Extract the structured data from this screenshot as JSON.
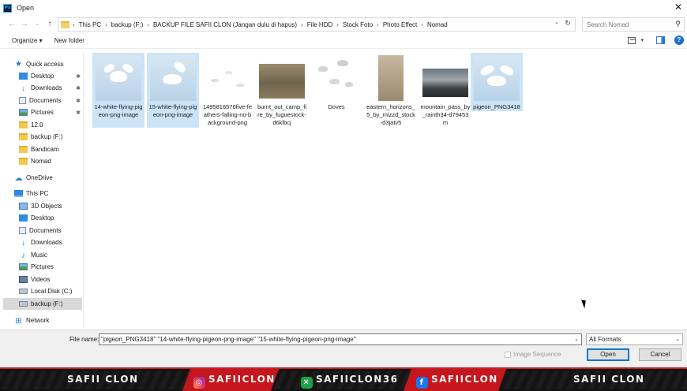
{
  "window": {
    "title": "Open",
    "app_icon": "Ps",
    "close_glyph": "✕"
  },
  "address": {
    "crumbs": [
      "This PC",
      "backup (F:)",
      "BACKUP FILE SAFII CLON (Jangan dulu di hapus)",
      "File HDD",
      "Stock Foto",
      "Photo Effect",
      "Nomad"
    ],
    "separator": "›",
    "search_placeholder": "Search Nomad"
  },
  "toolbar": {
    "organize": "Organize ▾",
    "new_folder": "New folder"
  },
  "sidebar": {
    "items": [
      {
        "label": "Quick access",
        "icon": "star-icon"
      },
      {
        "label": "Desktop",
        "icon": "desktop-icon",
        "pinned": true
      },
      {
        "label": "Downloads",
        "icon": "download-icon",
        "pinned": true
      },
      {
        "label": "Documents",
        "icon": "documents-icon",
        "pinned": true
      },
      {
        "label": "Pictures",
        "icon": "pictures-icon",
        "pinned": true
      },
      {
        "label": "12.0",
        "icon": "folder-icon"
      },
      {
        "label": "backup (F:)",
        "icon": "folder-icon"
      },
      {
        "label": "Bandicam",
        "icon": "folder-icon"
      },
      {
        "label": "Nomad",
        "icon": "folder-icon"
      },
      {
        "label": "OneDrive",
        "icon": "cloud-icon"
      },
      {
        "label": "This PC",
        "icon": "computer-icon"
      },
      {
        "label": "3D Objects",
        "icon": "3d-objects-icon"
      },
      {
        "label": "Desktop",
        "icon": "desktop-icon"
      },
      {
        "label": "Documents",
        "icon": "documents-icon"
      },
      {
        "label": "Downloads",
        "icon": "download-icon"
      },
      {
        "label": "Music",
        "icon": "music-icon"
      },
      {
        "label": "Pictures",
        "icon": "pictures-icon"
      },
      {
        "label": "Videos",
        "icon": "videos-icon"
      },
      {
        "label": "Local Disk (C:)",
        "icon": "drive-icon"
      },
      {
        "label": "backup (F:)",
        "icon": "drive-icon"
      },
      {
        "label": "Network",
        "icon": "network-icon"
      }
    ],
    "pin_glyph": "✱"
  },
  "files": [
    {
      "name": "14-white-flying-pigeon-png-image",
      "selected": true,
      "thumb": "pigeon"
    },
    {
      "name": "15-white-flying-pigeon-png-image",
      "selected": true,
      "thumb": "pigeon"
    },
    {
      "name": "1495816576five-feathers-falling-no-background-png",
      "selected": false,
      "thumb": "feathers"
    },
    {
      "name": "burnt_out_camp_fire_by_fuguestock-d6klbcj",
      "selected": false,
      "thumb": "campfire"
    },
    {
      "name": "Doves",
      "selected": false,
      "thumb": "doves"
    },
    {
      "name": "eastern_horizons_5_by_mizzd_stock-d3jatv5",
      "selected": false,
      "thumb": "woman"
    },
    {
      "name": "mountain_pass_by_rainth34-d79453m",
      "selected": false,
      "thumb": "mountain"
    },
    {
      "name": "pigeon_PNG3418",
      "selected": true,
      "thumb": "pigeon"
    }
  ],
  "footer": {
    "file_name_label": "File name:",
    "file_name_value": "\"pigeon_PNG3418\" \"14-white-flying-pigeon-png-image\" \"15-white-flying-pigeon-png-image\"",
    "format": "All Formats",
    "image_sequence": "Image Sequence",
    "open": "Open",
    "cancel": "Cancel"
  },
  "banner": {
    "left": "SAFII CLON",
    "instagram": "SAFIICLON",
    "other": "SAFIICLON36",
    "facebook": "SAFIICLON",
    "right": "SAFII CLON"
  },
  "colors": {
    "selection": "#cce4f7",
    "accent": "#0078d7",
    "banner_red": "#c4161c"
  }
}
